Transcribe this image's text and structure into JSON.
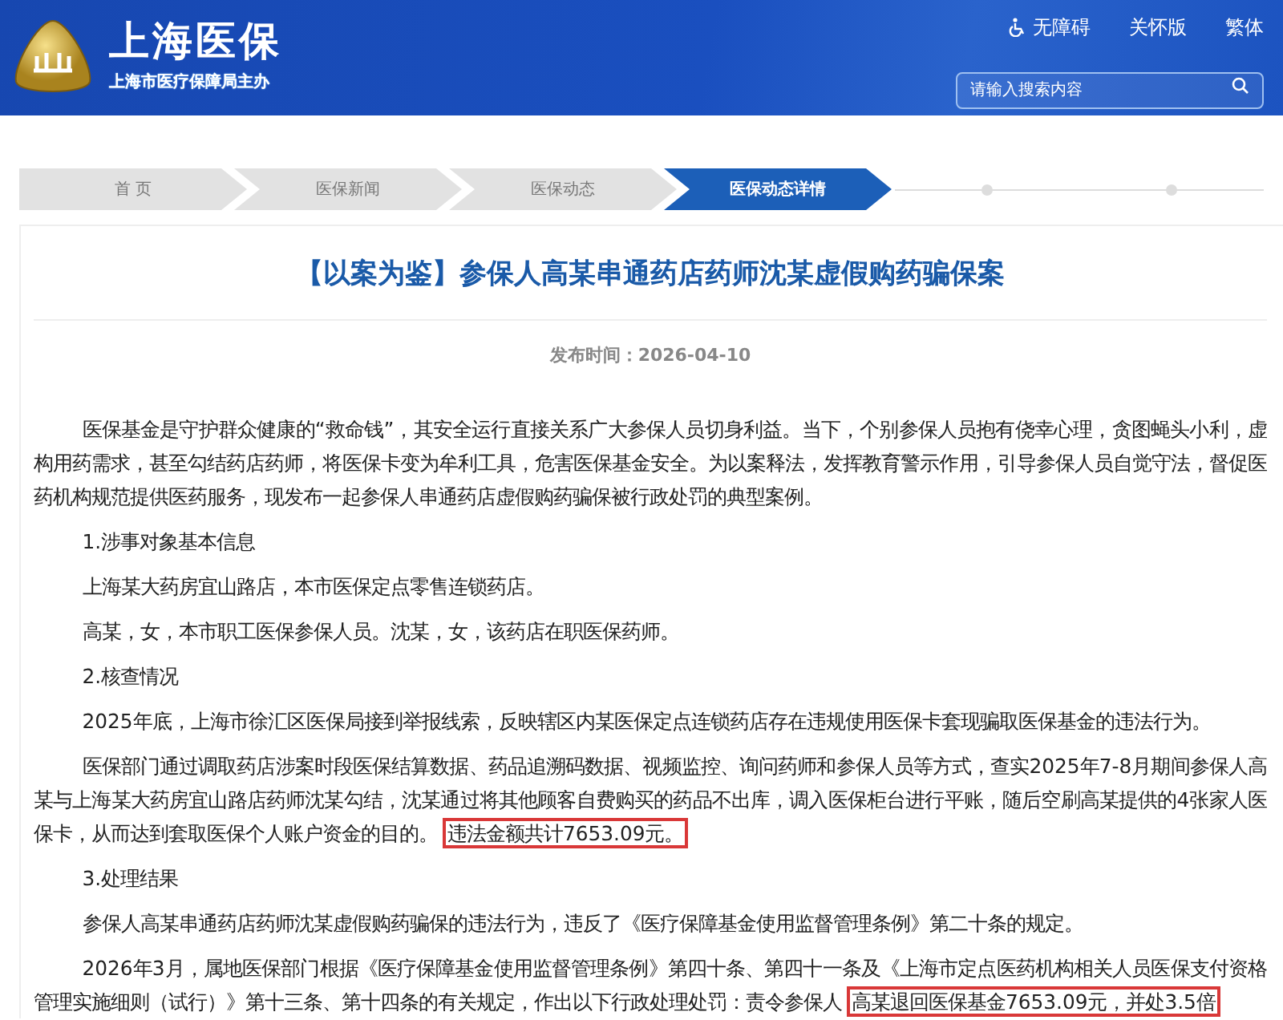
{
  "header": {
    "site_title": "上海医保",
    "subtitle": "上海市医疗保障局主办",
    "links": [
      {
        "kind": "accessibility",
        "label": "无障碍"
      },
      {
        "kind": "plain",
        "label": "关怀版"
      },
      {
        "kind": "plain",
        "label": "繁体"
      }
    ],
    "search": {
      "placeholder": "请输入搜索内容"
    }
  },
  "breadcrumb": [
    {
      "label": "首 页",
      "selected": false
    },
    {
      "label": "医保新闻",
      "selected": false
    },
    {
      "label": "医保动态",
      "selected": false
    },
    {
      "label": "医保动态详情",
      "selected": true
    }
  ],
  "article": {
    "title": "【以案为鉴】参保人高某串通药店药师沈某虚假购药骗保案",
    "date": "发布时间：2026-04-10",
    "paragraphs": [
      {
        "segments": [
          {
            "text": "医保基金是守护群众健康的“救命钱”，其安全运行直接关系广大参保人员切身利益。当下，个别参保人员抱有侥幸心理，贪图蝇头小利，虚构用药需求，甚至勾结药店药师，将医保卡变为牟利工具，危害医保基金安全。为以案释法，发挥教育警示作用，引导参保人员自觉守法，督促医药机构规范提供医药服务，现发布一起参保人串通药店虚假购药骗保被行政处罚的典型案例。",
            "highlighted": false
          }
        ]
      },
      {
        "segments": [
          {
            "text": "1.涉事对象基本信息",
            "highlighted": false
          }
        ]
      },
      {
        "segments": [
          {
            "text": "上海某大药房宜山路店，本市医保定点零售连锁药店。",
            "highlighted": false
          }
        ]
      },
      {
        "segments": [
          {
            "text": "高某，女，本市职工医保参保人员。沈某，女，该药店在职医保药师。",
            "highlighted": false
          }
        ]
      },
      {
        "segments": [
          {
            "text": "2.核查情况",
            "highlighted": false
          }
        ]
      },
      {
        "segments": [
          {
            "text": "2025年底，上海市徐汇区医保局接到举报线索，反映辖区内某医保定点连锁药店存在违规使用医保卡套现骗取医保基金的违法行为。",
            "highlighted": false
          }
        ]
      },
      {
        "segments": [
          {
            "text": "医保部门通过调取药店涉案时段医保结算数据、药品追溯码数据、视频监控、询问药师和参保人员等方式，查实2025年7-8月期间参保人高某与上海某大药房宜山路店药师沈某勾结，沈某通过将其他顾客自费购买的药品不出库，调入医保柜台进行平账，随后空刷高某提供的4张家人医保卡，从而达到套取医保个人账户资金的目的。",
            "highlighted": false
          },
          {
            "text": "违法金额共计7653.09元。",
            "highlighted": true
          }
        ]
      },
      {
        "segments": [
          {
            "text": "3.处理结果",
            "highlighted": false
          }
        ]
      },
      {
        "segments": [
          {
            "text": "参保人高某串通药店药师沈某虚假购药骗保的违法行为，违反了《医疗保障基金使用监督管理条例》第二十条的规定。",
            "highlighted": false
          }
        ]
      },
      {
        "segments": [
          {
            "text": "2026年3月，属地医保部门根据《医疗保障基金使用监督管理条例》第四十条、第四十一条及《上海市定点医药机构相关人员医保支付资格管理实施细则（试行）》第十三条、第十四条的有关规定，作出以下行政处理处罚：责令参保人",
            "highlighted": false
          },
          {
            "text": "高某退回医保基金7653.09元，并处3.5倍",
            "highlighted": true
          }
        ]
      }
    ]
  }
}
